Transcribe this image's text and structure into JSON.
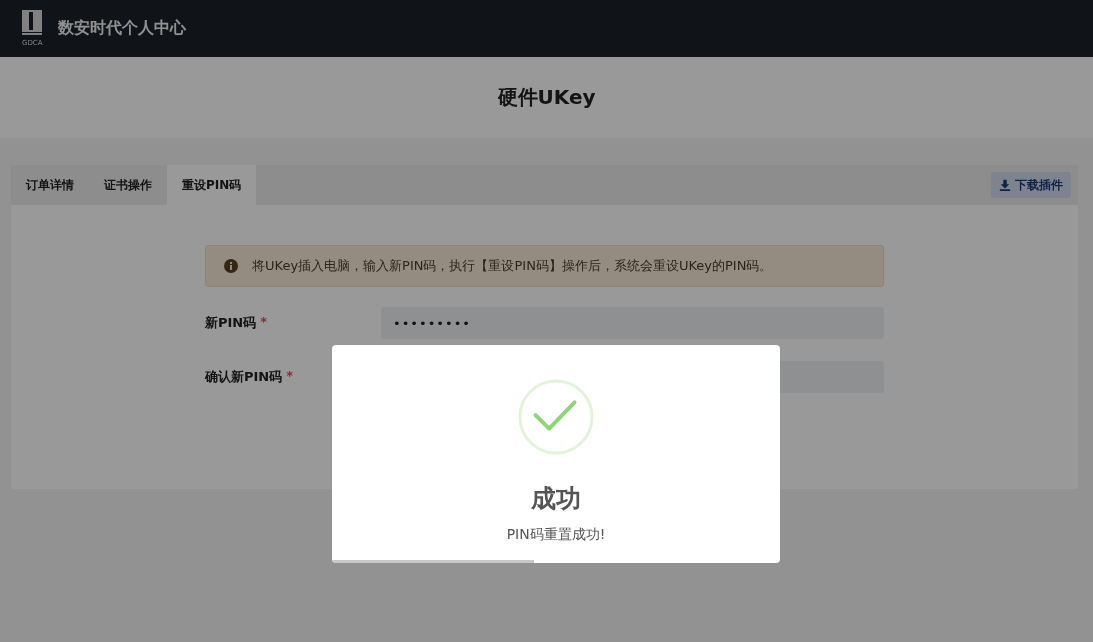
{
  "header": {
    "logo_text": "GDCA",
    "title": "数安时代个人中心"
  },
  "page_title": "硬件UKey",
  "tabs": [
    {
      "label": "订单详情",
      "selected": false
    },
    {
      "label": "证书操作",
      "selected": false
    },
    {
      "label": "重设PIN码",
      "selected": true
    }
  ],
  "download_button": "下载插件",
  "alert": {
    "kind": "info",
    "text": "将UKey插入电脑，输入新PIN码，执行【重设PIN码】操作后，系统会重设UKey的PIN码。"
  },
  "form": [
    {
      "label": "新PIN码",
      "required_mark": "*",
      "value": "•••••••••"
    },
    {
      "label": "确认新PIN码",
      "required_mark": "*"
    }
  ],
  "modal": {
    "kind": "success",
    "title": "成功",
    "message": "PIN码重置成功!",
    "timer": {
      "level": 0.45
    }
  }
}
